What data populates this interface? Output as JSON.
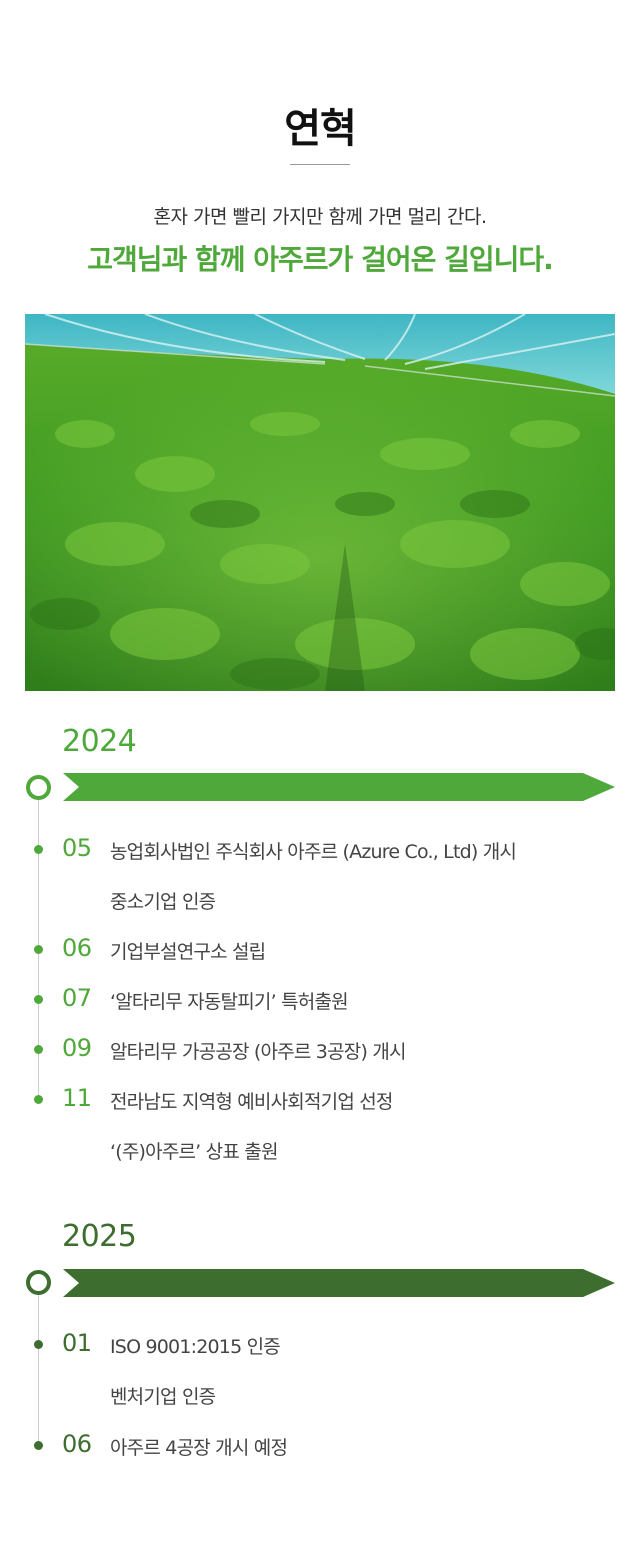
{
  "header": {
    "title": "연혁",
    "subtitle": "혼자 가면 빨리 가지만 함께 가면 멀리 간다.",
    "headline": "고객님과 함께 아주르가 걸어온 길입니다."
  },
  "colors": {
    "accent_2024": "#4ea83a",
    "accent_2025": "#3d6e2f",
    "text": "#444444"
  },
  "timeline": [
    {
      "year": "2024",
      "events": [
        {
          "month": "05",
          "lines": [
            "농업회사법인 주식회사 아주르 (Azure Co., Ltd) 개시",
            "중소기업 인증"
          ]
        },
        {
          "month": "06",
          "lines": [
            "기업부설연구소 설립"
          ]
        },
        {
          "month": "07",
          "lines": [
            "‘알타리무 자동탈피기’ 특허출원"
          ]
        },
        {
          "month": "09",
          "lines": [
            "알타리무 가공공장 (아주르 3공장) 개시"
          ]
        },
        {
          "month": "11",
          "lines": [
            "전라남도 지역형 예비사회적기업 선정",
            "‘(주)아주르’ 상표 출원"
          ]
        }
      ]
    },
    {
      "year": "2025",
      "events": [
        {
          "month": "01",
          "lines": [
            "ISO 9001:2015 인증",
            "벤처기업 인증"
          ]
        },
        {
          "month": "06",
          "lines": [
            "아주르 4공장 개시 예정"
          ]
        }
      ]
    }
  ]
}
